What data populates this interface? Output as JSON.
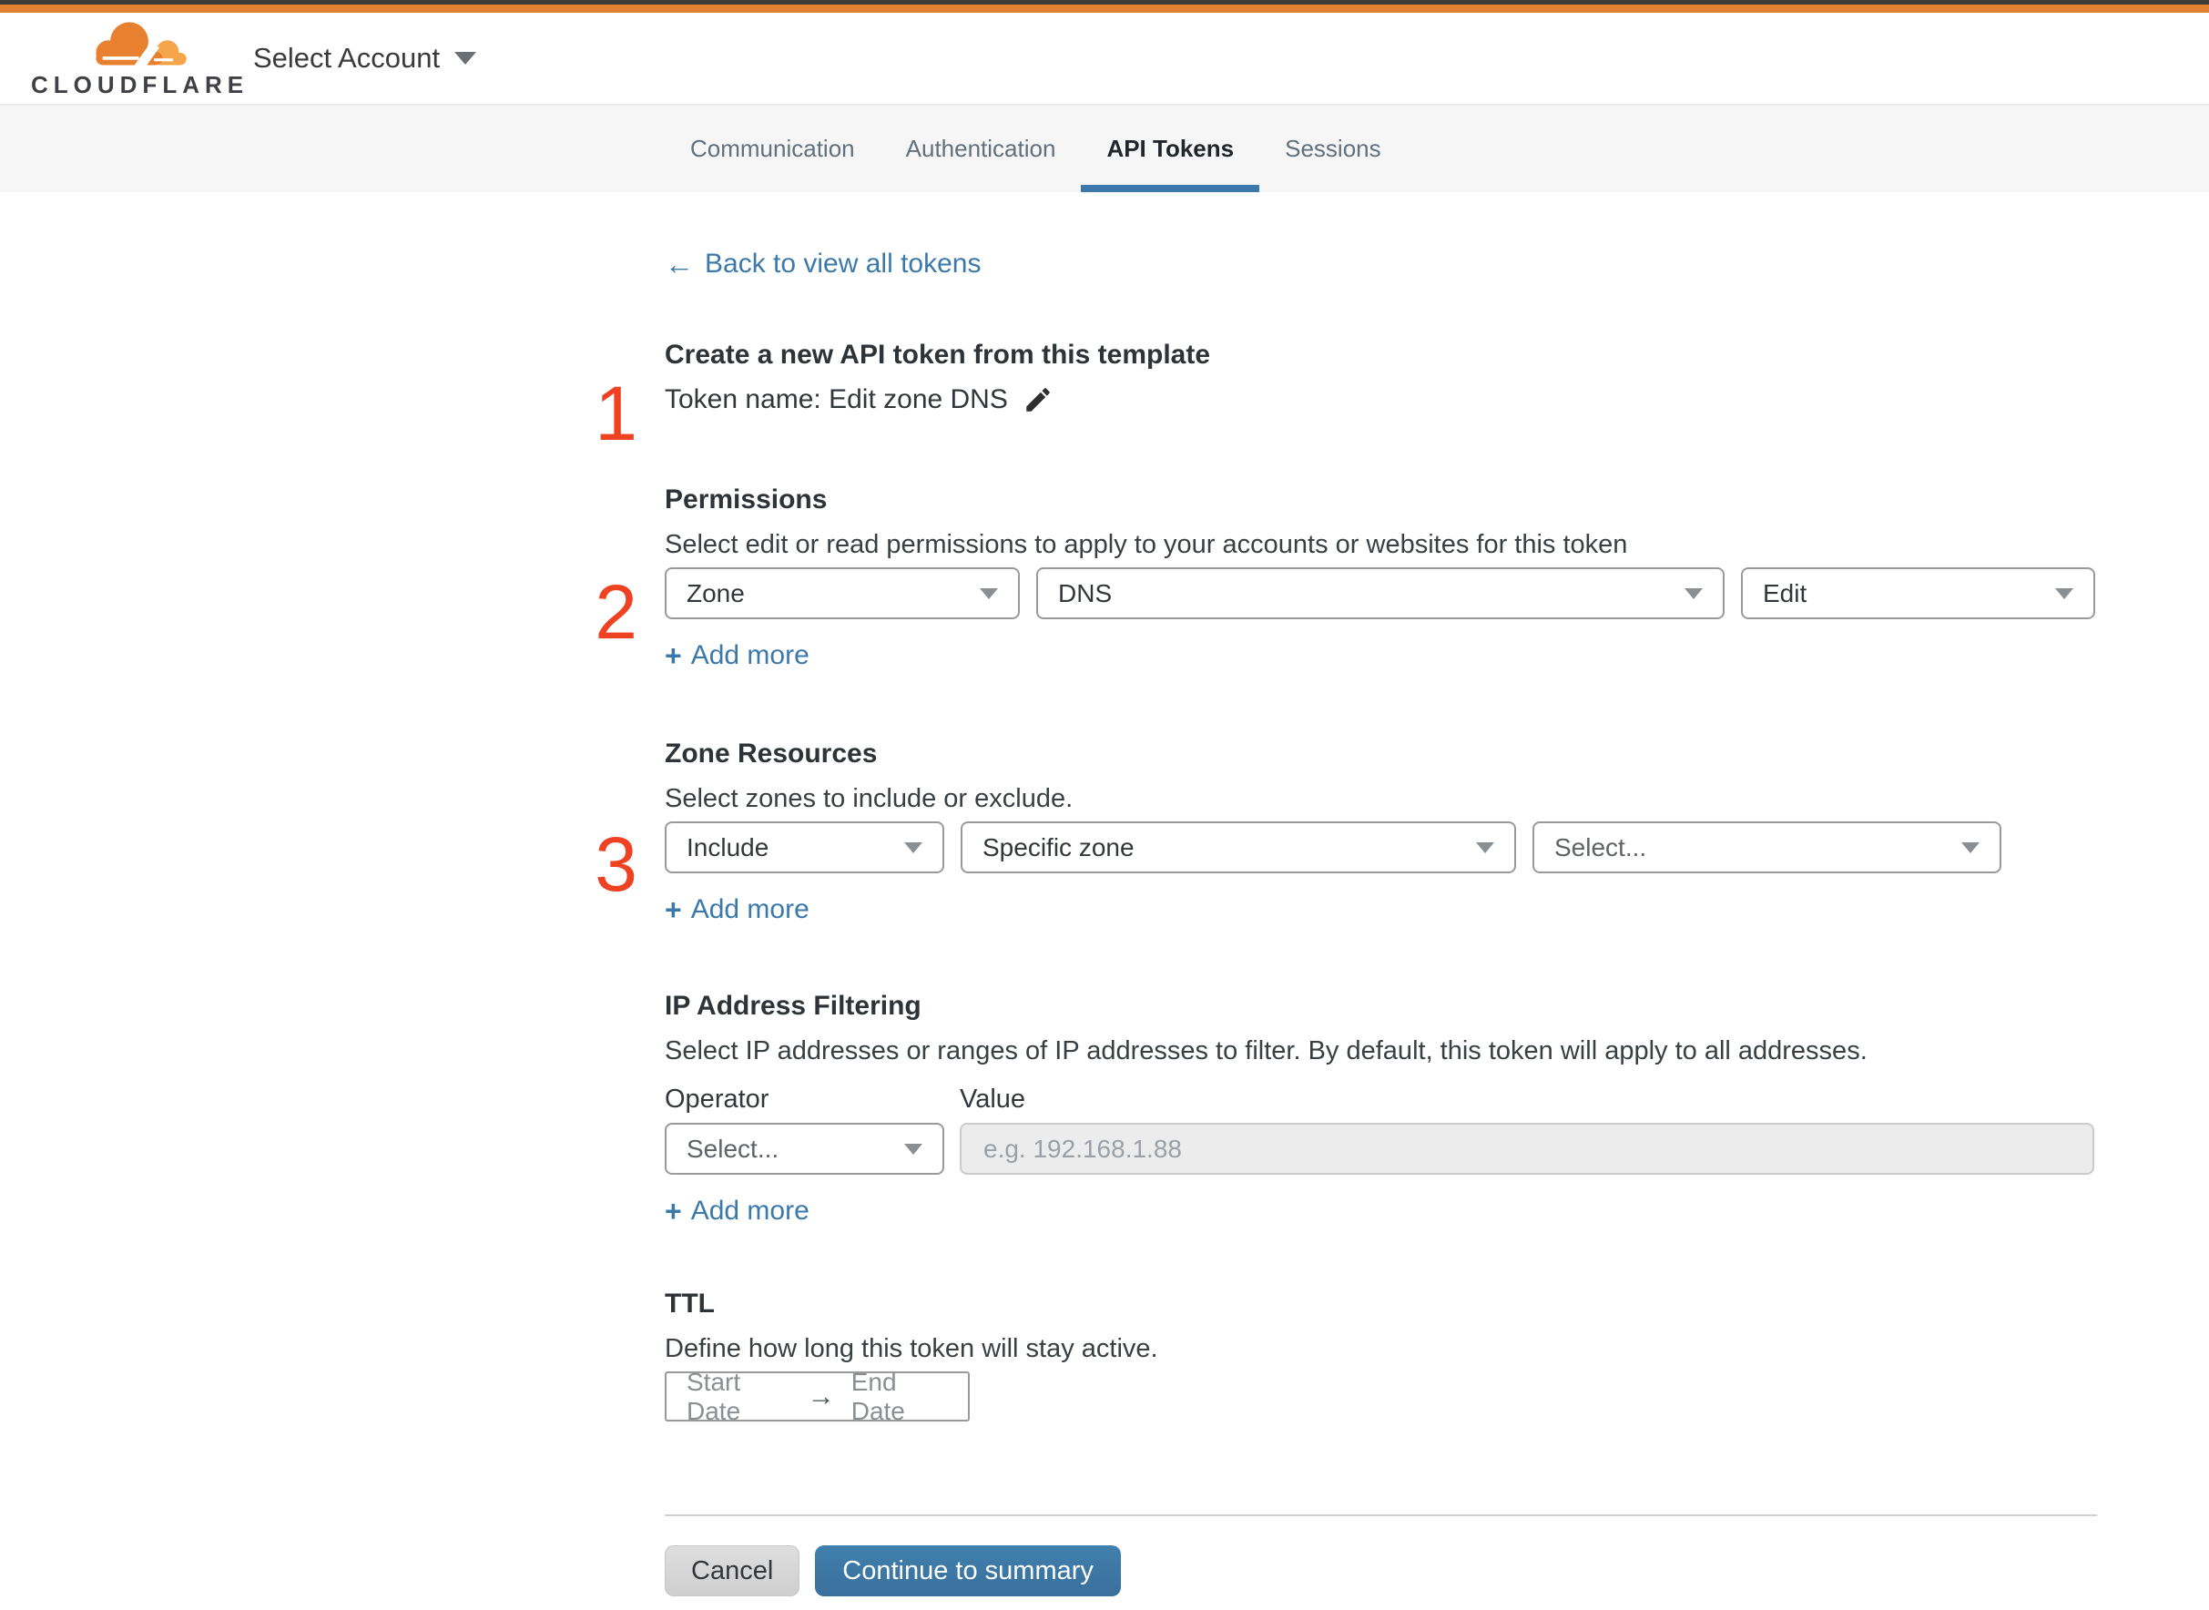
{
  "header": {
    "brand": "CLOUDFLARE",
    "account_label": "Select Account"
  },
  "tabs": [
    {
      "label": "Communication",
      "active": false
    },
    {
      "label": "Authentication",
      "active": false
    },
    {
      "label": "API Tokens",
      "active": true
    },
    {
      "label": "Sessions",
      "active": false
    }
  ],
  "back": {
    "label": "Back to view all tokens"
  },
  "steps": [
    "1",
    "2",
    "3"
  ],
  "token": {
    "heading": "Create a new API token from this template",
    "name_line": "Token name: Edit zone DNS"
  },
  "permissions": {
    "title": "Permissions",
    "description": "Select edit or read permissions to apply to your accounts or websites for this token",
    "scope_value": "Zone",
    "service_value": "DNS",
    "access_value": "Edit",
    "add_more_label": "Add more"
  },
  "zone_resources": {
    "title": "Zone Resources",
    "description": "Select zones to include or exclude.",
    "mode_value": "Include",
    "type_value": "Specific zone",
    "zone_placeholder": "Select...",
    "add_more_label": "Add more"
  },
  "ip_filtering": {
    "title": "IP Address Filtering",
    "description": "Select IP addresses or ranges of IP addresses to filter. By default, this token will apply to all addresses.",
    "operator_label": "Operator",
    "value_label": "Value",
    "operator_value": "Select...",
    "value_placeholder": "e.g. 192.168.1.88",
    "add_more_label": "Add more"
  },
  "ttl": {
    "title": "TTL",
    "description": "Define how long this token will stay active.",
    "start_label": "Start Date",
    "end_label": "End Date"
  },
  "footer": {
    "cancel_label": "Cancel",
    "continue_label": "Continue to summary"
  },
  "icons": {
    "plus": "+",
    "back_arrow": "←",
    "range_arrow": "→"
  },
  "colors": {
    "brand_orange": "#e08232",
    "topbar_dark": "#3e3a35",
    "step_number_red": "#ee4223",
    "link_blue": "#3c79ab",
    "primary_button_blue": "#3d76a5",
    "active_tab_underline": "#3b78ab",
    "tabbar_background": "#f6f6f7"
  }
}
